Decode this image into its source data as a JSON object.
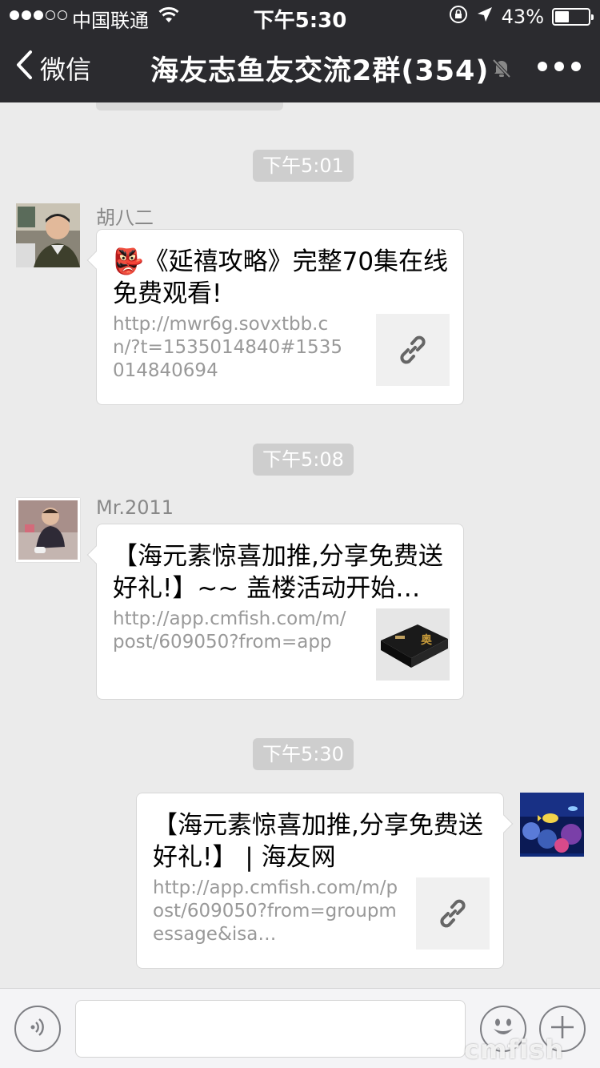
{
  "status_bar": {
    "carrier": "中国联通",
    "time": "下午5:30",
    "battery_percent": "43%",
    "battery_level": 0.43,
    "signal_bars_filled": 3,
    "signal_bars_total": 5
  },
  "nav": {
    "back_label": "微信",
    "title": "海友志鱼友交流2群(354)"
  },
  "messages": [
    {
      "time": "下午5:01",
      "sender": "胡八二",
      "emoji": "👺",
      "title": "《延禧攻略》完整70集在线免费观看!",
      "url": "http://mwr6g.sovxtbb.cn/?t=1535014840#1535014840694",
      "thumb": "link-icon"
    },
    {
      "time": "下午5:08",
      "sender": "Mr.2011",
      "title": "【海元素惊喜加推,分享免费送好礼!】~~ 盖楼活动开始…",
      "url": "http://app.cmfish.com/m/post/609050?from=app",
      "thumb": "product-box-image"
    },
    {
      "time": "下午5:30",
      "title": "【海元素惊喜加推,分享免费送好礼!】 | 海友网",
      "url": "http://app.cmfish.com/m/post/609050?from=groupmessage&isa…",
      "thumb": "link-icon"
    }
  ],
  "watermark": "cmfish",
  "colors": {
    "nav_bg": "#2b2b2f",
    "chat_bg": "#ebebeb",
    "time_badge_bg": "#cecece"
  }
}
